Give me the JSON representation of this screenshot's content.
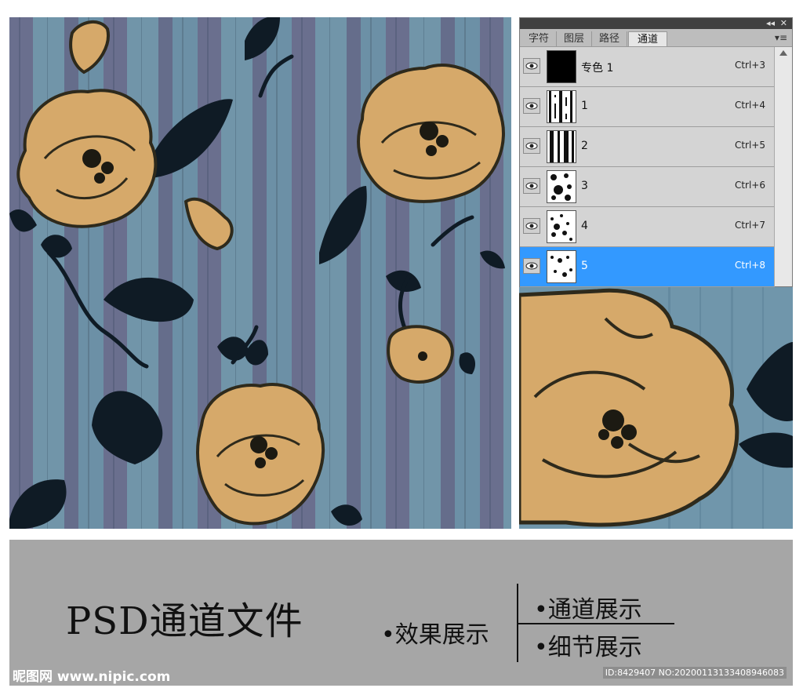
{
  "panel": {
    "tabs": [
      "字符",
      "图层",
      "路径",
      "通道"
    ],
    "active_tab": "通道",
    "channels": [
      {
        "name": "专色 1",
        "shortcut": "Ctrl+3",
        "selected": false
      },
      {
        "name": "1",
        "shortcut": "Ctrl+4",
        "selected": false
      },
      {
        "name": "2",
        "shortcut": "Ctrl+5",
        "selected": false
      },
      {
        "name": "3",
        "shortcut": "Ctrl+6",
        "selected": false
      },
      {
        "name": "4",
        "shortcut": "Ctrl+7",
        "selected": false
      },
      {
        "name": "5",
        "shortcut": "Ctrl+8",
        "selected": true
      }
    ],
    "controls": {
      "collapse": "◂◂",
      "close": "✕",
      "menu": "▾≡"
    }
  },
  "banner": {
    "title": "PSD通道文件",
    "effect_label": "•效果展示",
    "options": [
      "•通道展示",
      "•细节展示"
    ],
    "watermark": "昵图网 www.nipic.com",
    "id_text": "ID:8429407 NO:20200113133408946083"
  },
  "colors": {
    "stripe_light": "#6f94a8",
    "stripe_dark": "#6b6f90",
    "flower": "#d6a96a",
    "outline": "#2e2a1c",
    "leaf": "#0e1a24",
    "selection": "#3399ff"
  }
}
